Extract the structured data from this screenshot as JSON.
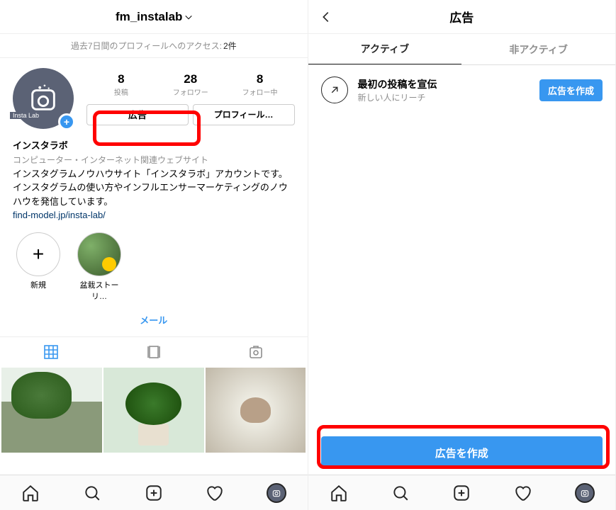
{
  "left": {
    "header": {
      "username": "fm_instalab"
    },
    "insights": {
      "text": "過去7日間のプロフィールへのアクセス:",
      "count": "2件"
    },
    "stats": {
      "posts": {
        "num": "8",
        "label": "投稿"
      },
      "followers": {
        "num": "28",
        "label": "フォロワー"
      },
      "following": {
        "num": "8",
        "label": "フォロー中"
      }
    },
    "buttons": {
      "ad": "広告",
      "edit_profile": "プロフィール…"
    },
    "avatar_label": "Insta Lab",
    "bio": {
      "name": "インスタラボ",
      "category": "コンピューター・インターネット関連ウェブサイト",
      "text": "インスタグラムノウハウサイト「インスタラボ」アカウントです。インスタグラムの使い方やインフルエンサーマーケティングのノウハウを発信しています。",
      "link": "find-model.jp/insta-lab/"
    },
    "highlights": {
      "new": "新規",
      "story": "盆栽ストーリ…"
    },
    "contact": "メール"
  },
  "right": {
    "header": {
      "title": "広告"
    },
    "tabs": {
      "active": "アクティブ",
      "inactive": "非アクティブ"
    },
    "entry": {
      "title": "最初の投稿を宣伝",
      "subtitle": "新しい人にリーチ",
      "button": "広告を作成"
    },
    "big_button": "広告を作成"
  }
}
